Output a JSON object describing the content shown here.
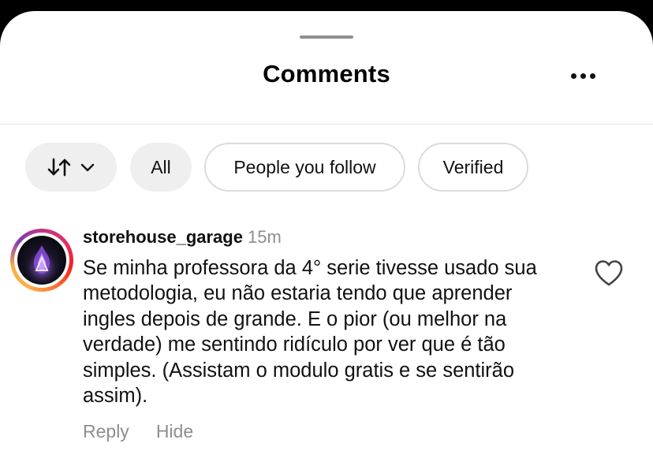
{
  "header": {
    "title": "Comments",
    "more_icon": "more-horizontal-icon"
  },
  "filters": {
    "sort_icon": "sort-arrows-icon",
    "chevron_icon": "chevron-down-icon",
    "chips": [
      {
        "label": "All",
        "selected": true
      },
      {
        "label": "People you follow",
        "selected": false
      },
      {
        "label": "Verified",
        "selected": false
      }
    ]
  },
  "comment": {
    "username": "storehouse_garage",
    "time": "15m",
    "text": "Se minha professora da 4° serie tivesse usado sua metodologia, eu não estaria tendo que aprender ingles depois de grande. E o pior (ou melhor na verdade) me sentindo ridículo por ver que é tão simples. (Assistam o modulo gratis e se sentirão assim).",
    "reply_label": "Reply",
    "hide_label": "Hide",
    "like_icon": "heart-outline-icon"
  },
  "colors": {
    "muted": "#8e8e8e",
    "chip_fill": "#efefef",
    "chip_border": "#dbdbdb"
  }
}
